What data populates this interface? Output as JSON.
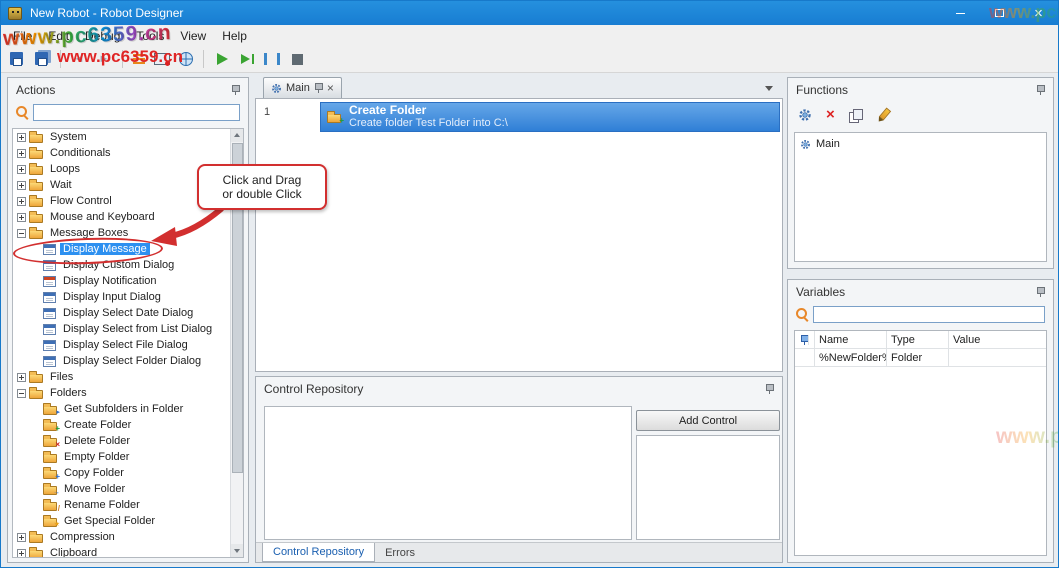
{
  "window": {
    "title": "New Robot - Robot Designer"
  },
  "watermark": {
    "text": "www.pc6359.cn"
  },
  "menu": {
    "items": [
      {
        "label": "File"
      },
      {
        "label": "Edit"
      },
      {
        "label": "Debug"
      },
      {
        "label": "Tools"
      },
      {
        "label": "View"
      },
      {
        "label": "Help"
      }
    ]
  },
  "toolbar": {
    "items": [
      {
        "name": "save-icon",
        "icon": "save",
        "inter": "true"
      },
      {
        "name": "save-all-icon",
        "icon": "save-all",
        "inter": "true"
      },
      {
        "name": "toolbar-separator",
        "icon": "separator",
        "inter": "false"
      },
      {
        "name": "undo-icon",
        "icon": "undo",
        "inter": "true"
      },
      {
        "name": "redo-icon",
        "icon": "redo",
        "inter": "true"
      },
      {
        "name": "toolbar-separator",
        "icon": "separator",
        "inter": "false"
      },
      {
        "name": "actions-list-icon",
        "icon": "list",
        "inter": "true"
      },
      {
        "name": "record-icon",
        "icon": "record",
        "inter": "true"
      },
      {
        "name": "publish-globe-icon",
        "icon": "globe",
        "inter": "true"
      },
      {
        "name": "toolbar-separator",
        "icon": "separator",
        "inter": "false"
      },
      {
        "name": "run-icon",
        "icon": "run",
        "inter": "true"
      },
      {
        "name": "step-icon",
        "icon": "step",
        "inter": "true"
      },
      {
        "name": "pause-icon",
        "icon": "pause",
        "inter": "true"
      },
      {
        "name": "stop-icon",
        "icon": "stop",
        "inter": "true"
      }
    ]
  },
  "actions": {
    "title": "Actions",
    "callout": {
      "line1": "Click and Drag",
      "line2": "or double Click"
    },
    "tree": [
      {
        "label": "System",
        "depth": 0,
        "expander": "plus",
        "icon": "folder",
        "selected": false
      },
      {
        "label": "Conditionals",
        "depth": 0,
        "expander": "plus",
        "icon": "folder",
        "selected": false
      },
      {
        "label": "Loops",
        "depth": 0,
        "expander": "plus",
        "icon": "folder",
        "selected": false
      },
      {
        "label": "Wait",
        "depth": 0,
        "expander": "plus",
        "icon": "folder",
        "selected": false
      },
      {
        "label": "Flow Control",
        "depth": 0,
        "expander": "plus",
        "icon": "folder",
        "selected": false
      },
      {
        "label": "Mouse and Keyboard",
        "depth": 0,
        "expander": "plus",
        "icon": "folder",
        "selected": false
      },
      {
        "label": "Message Boxes",
        "depth": 0,
        "expander": "minus",
        "icon": "folder",
        "selected": false
      },
      {
        "label": "Display Message",
        "depth": 1,
        "expander": "none",
        "icon": "dlg-message",
        "selected": true
      },
      {
        "label": "Display Custom Dialog",
        "depth": 1,
        "expander": "none",
        "icon": "dlg-custom",
        "selected": false
      },
      {
        "label": "Display Notification",
        "depth": 1,
        "expander": "none",
        "icon": "dlg-notification",
        "selected": false
      },
      {
        "label": "Display Input Dialog",
        "depth": 1,
        "expander": "none",
        "icon": "dlg-input",
        "selected": false
      },
      {
        "label": "Display Select Date Dialog",
        "depth": 1,
        "expander": "none",
        "icon": "dlg-date",
        "selected": false
      },
      {
        "label": "Display Select from List Dialog",
        "depth": 1,
        "expander": "none",
        "icon": "dlg-list",
        "selected": false
      },
      {
        "label": "Display Select File Dialog",
        "depth": 1,
        "expander": "none",
        "icon": "dlg-file",
        "selected": false
      },
      {
        "label": "Display Select Folder Dialog",
        "depth": 1,
        "expander": "none",
        "icon": "dlg-folder",
        "selected": false
      },
      {
        "label": "Files",
        "depth": 0,
        "expander": "plus",
        "icon": "folder",
        "selected": false
      },
      {
        "label": "Folders",
        "depth": 0,
        "expander": "minus",
        "icon": "folder",
        "selected": false
      },
      {
        "label": "Get Subfolders in Folder",
        "depth": 1,
        "expander": "none",
        "icon": "folder-subfolders",
        "selected": false
      },
      {
        "label": "Create Folder",
        "depth": 1,
        "expander": "none",
        "icon": "folder-create",
        "selected": false
      },
      {
        "label": "Delete Folder",
        "depth": 1,
        "expander": "none",
        "icon": "folder-delete",
        "selected": false
      },
      {
        "label": "Empty Folder",
        "depth": 1,
        "expander": "none",
        "icon": "folder-empty",
        "selected": false
      },
      {
        "label": "Copy Folder",
        "depth": 1,
        "expander": "none",
        "icon": "folder-copy",
        "selected": false
      },
      {
        "label": "Move Folder",
        "depth": 1,
        "expander": "none",
        "icon": "folder-move",
        "selected": false
      },
      {
        "label": "Rename Folder",
        "depth": 1,
        "expander": "none",
        "icon": "folder-rename",
        "selected": false
      },
      {
        "label": "Get Special Folder",
        "depth": 1,
        "expander": "none",
        "icon": "folder-special",
        "selected": false
      },
      {
        "label": "Compression",
        "depth": 0,
        "expander": "plus",
        "icon": "folder",
        "selected": false
      },
      {
        "label": "Clipboard",
        "depth": 0,
        "expander": "plus",
        "icon": "folder",
        "selected": false
      }
    ]
  },
  "editor": {
    "tab": "Main",
    "rows": [
      {
        "num": "1",
        "title": "Create Folder",
        "desc": "Create folder Test Folder into C:\\"
      }
    ]
  },
  "control_repository": {
    "title": "Control Repository",
    "add_button": "Add Control",
    "tabs": [
      {
        "label": "Control Repository",
        "active": true
      },
      {
        "label": "Errors",
        "active": false
      }
    ]
  },
  "functions": {
    "title": "Functions",
    "items": [
      {
        "label": "Main"
      }
    ]
  },
  "variables": {
    "title": "Variables",
    "columns": [
      "Name",
      "Type",
      "Value"
    ],
    "rows": [
      {
        "name": "%NewFolder%",
        "type": "Folder",
        "value": ""
      }
    ]
  }
}
